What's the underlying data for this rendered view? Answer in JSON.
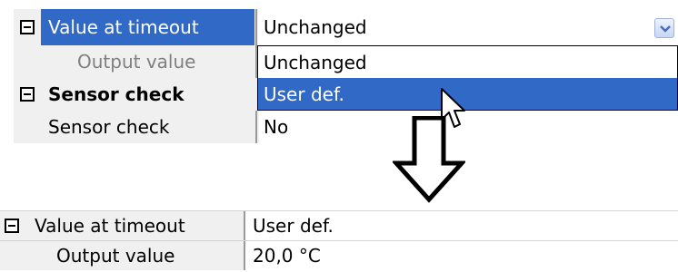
{
  "top_grid": {
    "rows": [
      {
        "label": "Value at timeout",
        "value": "Unchanged"
      },
      {
        "label": "Output value",
        "value": ""
      },
      {
        "label": "Sensor check",
        "value": ""
      },
      {
        "label": "Sensor check",
        "value": "No"
      }
    ],
    "dropdown_options": [
      "Unchanged",
      "User def."
    ],
    "highlighted_option": "User def."
  },
  "bottom_grid": {
    "rows": [
      {
        "label": "Value at timeout",
        "value": "User def."
      },
      {
        "label": "Output value",
        "value": "20,0 °C"
      }
    ]
  },
  "icons": {
    "expander": "collapse-minus-icon",
    "dropdown": "chevron-down-icon",
    "cursor": "mouse-pointer-icon",
    "arrow": "down-arrow-icon"
  },
  "colors": {
    "selection": "#3169c6",
    "row_background": "#f0f0f0"
  }
}
